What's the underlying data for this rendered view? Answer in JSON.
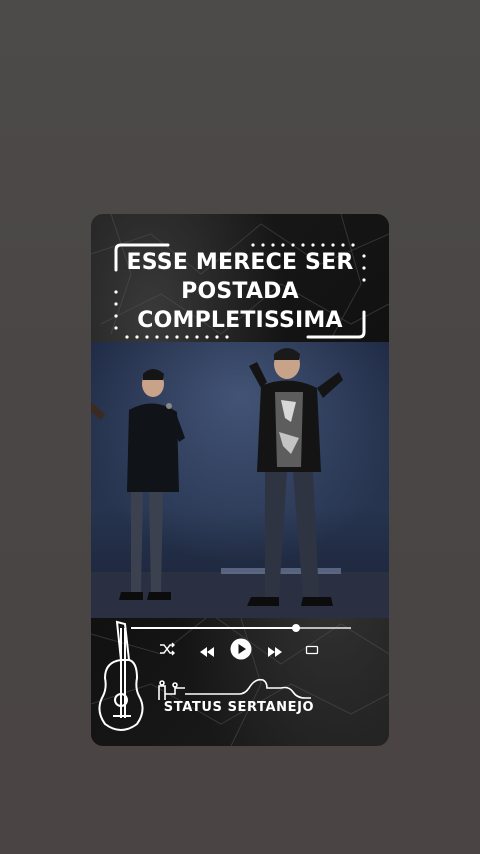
{
  "headline": {
    "line1": "ESSE MERECE SER",
    "line2": "POSTADA",
    "line3": "COMPLETISSIMA"
  },
  "player": {
    "progress": 0.75,
    "shuffle_icon": "shuffle-icon",
    "prev_icon": "rewind-icon",
    "play_icon": "play-icon",
    "next_icon": "fast-forward-icon",
    "repeat_icon": "repeat-icon"
  },
  "brand": {
    "name": "STATUS SERTANEJO"
  },
  "colors": {
    "background": "#4b4747",
    "card": "#161616",
    "text": "#ffffff",
    "stage_blue": "#2a3a5c"
  }
}
